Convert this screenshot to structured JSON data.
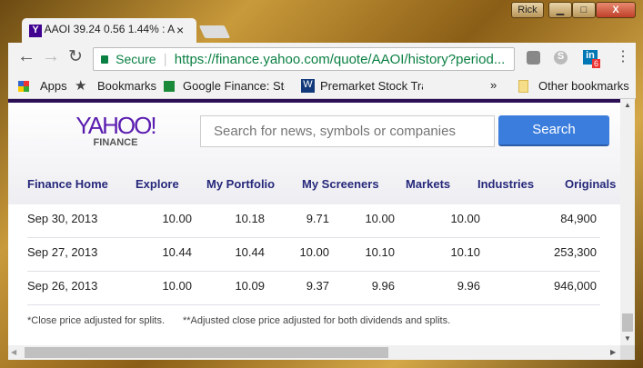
{
  "window": {
    "user": "Rick",
    "minimize": "▁",
    "maximize": "□",
    "close": "X"
  },
  "tab": {
    "title": "AAOI 39.24 0.56 1.44% : A",
    "close": "×"
  },
  "toolbar": {
    "secure": "Secure",
    "url": "https://finance.yahoo.com/quote/AAOI/history?period...",
    "linkedin_badge": "6"
  },
  "bookmarks": {
    "items": [
      "Apps",
      "Bookmarks",
      "Google Finance: Stoc",
      "Premarket Stock Trad"
    ],
    "overflow": "»",
    "other": "Other bookmarks"
  },
  "header": {
    "logo": "YAHOO!",
    "logo_sub": "FINANCE",
    "search_placeholder": "Search for news, symbols or companies",
    "search_button": "Search"
  },
  "nav": [
    "Finance Home",
    "Explore",
    "My Portfolio",
    "My Screeners",
    "Markets",
    "Industries",
    "Originals"
  ],
  "table": {
    "rows": [
      [
        "Sep 30, 2013",
        "10.00",
        "10.18",
        "9.71",
        "10.00",
        "10.00",
        "84,900"
      ],
      [
        "Sep 27, 2013",
        "10.44",
        "10.44",
        "10.00",
        "10.10",
        "10.10",
        "253,300"
      ],
      [
        "Sep 26, 2013",
        "10.00",
        "10.09",
        "9.37",
        "9.96",
        "9.96",
        "946,000"
      ]
    ]
  },
  "footnotes": [
    "*Close price adjusted for splits.",
    "**Adjusted close price adjusted for both dividends and splits."
  ],
  "colors": {
    "accent": "#3b7ddd",
    "nav": "#26287a",
    "brand": "#400090"
  }
}
